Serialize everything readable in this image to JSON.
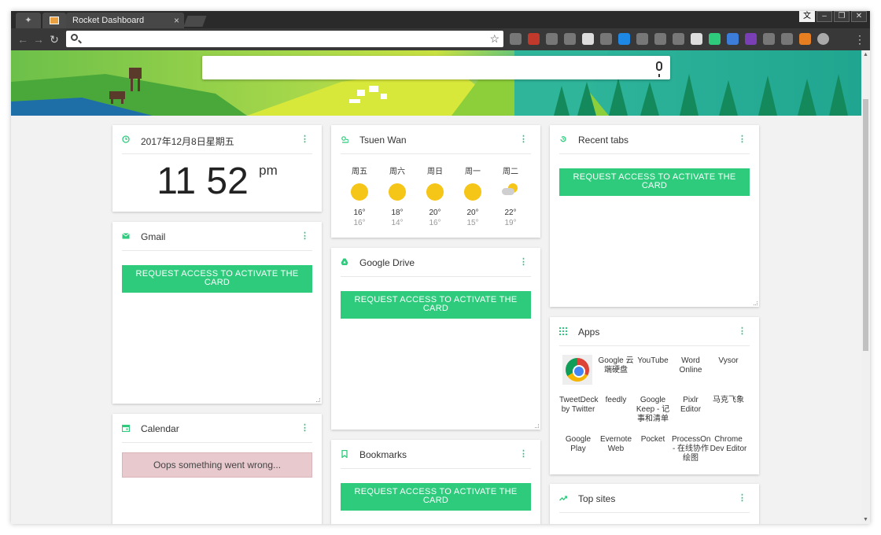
{
  "browser": {
    "tab_title": "Rocket Dashboard",
    "tab_close": "×",
    "lang_button": "文",
    "minimize": "–",
    "restore": "❐",
    "close": "✕",
    "address": ""
  },
  "clock": {
    "date": "2017年12月8日星期五",
    "hour": "11",
    "minute": "52",
    "ampm": "pm"
  },
  "weather": {
    "location": "Tsuen Wan",
    "days": [
      {
        "day": "周五",
        "icon": "sun-icon",
        "high": "16°",
        "low": "16°"
      },
      {
        "day": "周六",
        "icon": "sun-icon",
        "high": "18°",
        "low": "14°"
      },
      {
        "day": "周日",
        "icon": "sun-icon",
        "high": "20°",
        "low": "16°"
      },
      {
        "day": "周一",
        "icon": "sun-icon",
        "high": "20°",
        "low": "15°"
      },
      {
        "day": "周二",
        "icon": "sun-rain-icon",
        "high": "22°",
        "low": "19°"
      }
    ]
  },
  "recent_tabs": {
    "title": "Recent tabs"
  },
  "gmail": {
    "title": "Gmail"
  },
  "google_drive": {
    "title": "Google Drive"
  },
  "calendar": {
    "title": "Calendar",
    "error": "Oops something went wrong..."
  },
  "bookmarks": {
    "title": "Bookmarks"
  },
  "apps": {
    "title": "Apps",
    "items": [
      "Google 云端硬盘",
      "YouTube",
      "Word Online",
      "Vysor",
      "TweetDeck by Twitter",
      "feedly",
      "Google Keep - 记事和清单",
      "Pixlr Editor",
      "马克飞象",
      "Google Play",
      "Evernote Web",
      "Pocket",
      "ProcessOn - 在线协作绘图",
      "Chrome Dev Editor"
    ]
  },
  "top_sites": {
    "title": "Top sites"
  },
  "common": {
    "request_access": "REQUEST ACCESS TO ACTIVATE THE CARD",
    "menu": "⋮"
  },
  "colors": {
    "accent": "#2ecb7c",
    "error_bg": "#e8c9ce"
  }
}
